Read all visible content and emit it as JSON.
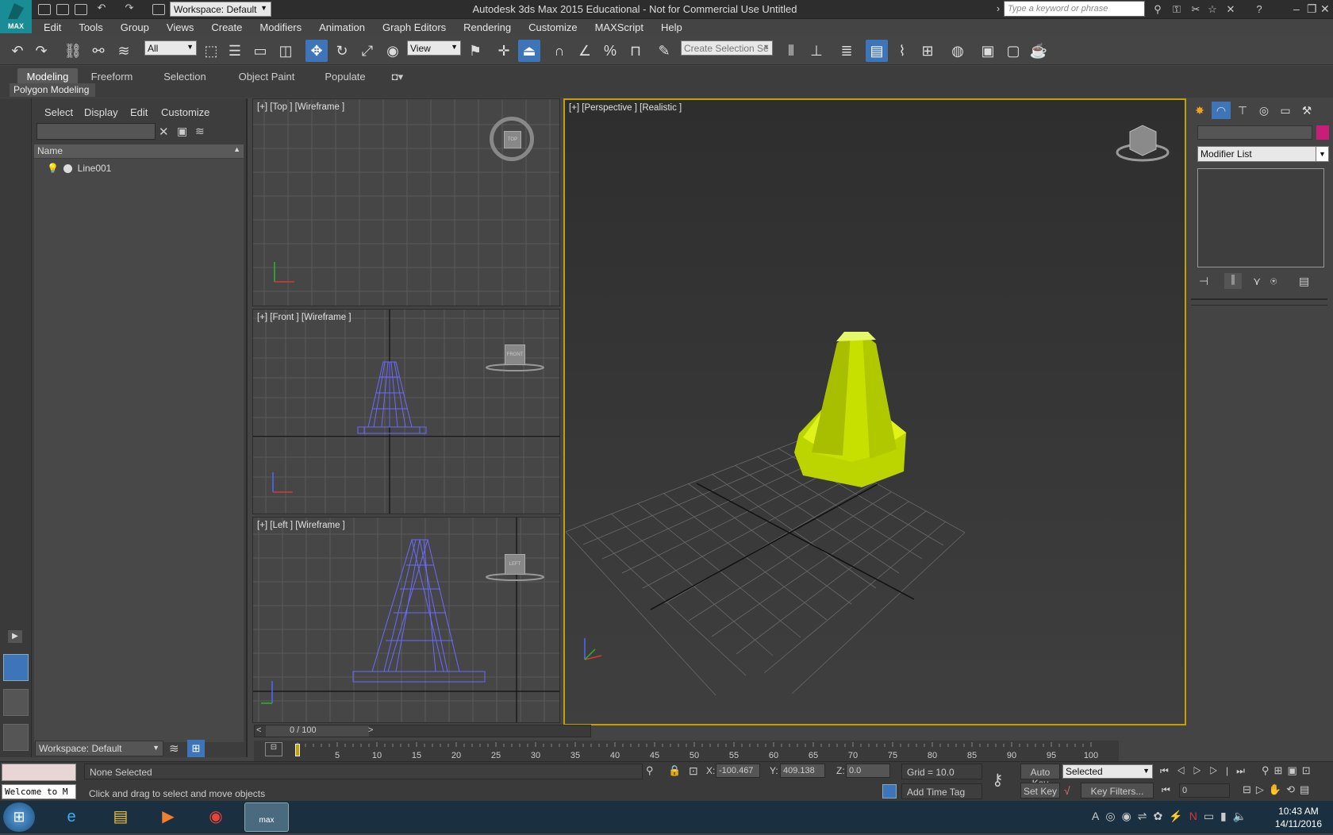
{
  "app": {
    "logo_text": "MAX",
    "title": "Autodesk 3ds Max  2015  Educational  -  Not for Commercial Use    Untitled",
    "workspace": "Workspace: Default",
    "search_placeholder": "Type a keyword or phrase"
  },
  "menu": [
    "Edit",
    "Tools",
    "Group",
    "Views",
    "Create",
    "Modifiers",
    "Animation",
    "Graph Editors",
    "Rendering",
    "Customize",
    "MAXScript",
    "Help"
  ],
  "toolbar": {
    "filter_value": "All",
    "coord_value": "View",
    "selection_set_placeholder": "Create Selection Se"
  },
  "ribbon": {
    "tabs": [
      "Modeling",
      "Freeform",
      "Selection",
      "Object Paint",
      "Populate"
    ],
    "active_tab": "Modeling",
    "panel_label": "Polygon Modeling"
  },
  "scene_explorer": {
    "menus": [
      "Select",
      "Display",
      "Edit",
      "Customize"
    ],
    "column_header": "Name",
    "objects": [
      "Line001"
    ],
    "workspace": "Workspace: Default"
  },
  "viewports": {
    "top": {
      "label": "[+] [Top ] [Wireframe ]",
      "cube": "TOP"
    },
    "front": {
      "label": "[+] [Front ] [Wireframe ]",
      "cube": "FRONT"
    },
    "left": {
      "label": "[+] [Left ] [Wireframe ]",
      "cube": "LEFT"
    },
    "perspective": {
      "label": "[+] [Perspective ] [Realistic ]"
    }
  },
  "command_panel": {
    "modifier_list": "Modifier List",
    "object_color": "#c81e7a"
  },
  "timeline": {
    "slider_label": "0 / 100",
    "ticks": [
      0,
      5,
      10,
      15,
      20,
      25,
      30,
      35,
      40,
      45,
      50,
      55,
      60,
      65,
      70,
      75,
      80,
      85,
      90,
      95,
      100
    ],
    "current_frame": "0"
  },
  "status": {
    "welcome": "Welcome to M",
    "selection": "None Selected",
    "prompt": "Click and drag to select and move objects",
    "x_label": "X:",
    "x_value": "-100.467",
    "y_label": "Y:",
    "y_value": "409.138",
    "z_label": "Z:",
    "z_value": "0.0",
    "grid": "Grid = 10.0",
    "add_time_tag": "Add Time Tag",
    "auto_key": "Auto Key",
    "set_key": "Set Key",
    "key_mode": "Selected",
    "key_filters": "Key Filters..."
  },
  "taskbar": {
    "time": "10:43 AM",
    "date": "14/11/2016",
    "max_label": "max"
  },
  "colors": {
    "cone": "#c8e000",
    "wireframe": "#6a6aff",
    "accent": "#3d75b8",
    "active_viewport_border": "#c4a000"
  }
}
